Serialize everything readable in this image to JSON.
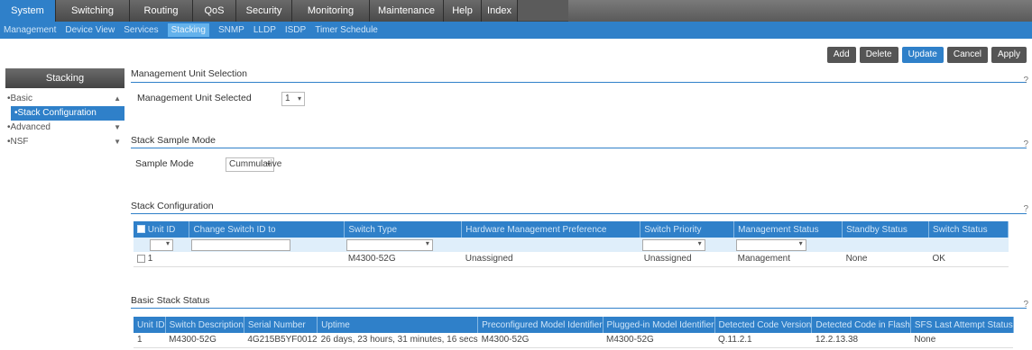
{
  "topnav": {
    "tabs": [
      {
        "label": "System",
        "active": true
      },
      {
        "label": "Switching",
        "active": false
      },
      {
        "label": "Routing",
        "active": false
      },
      {
        "label": "QoS",
        "active": false
      },
      {
        "label": "Security",
        "active": false
      },
      {
        "label": "Monitoring",
        "active": false
      },
      {
        "label": "Maintenance",
        "active": false
      },
      {
        "label": "Help",
        "active": false
      },
      {
        "label": "Index",
        "active": false
      }
    ]
  },
  "subnav": {
    "items": [
      "Management",
      "Device View",
      "Services",
      "Stacking",
      "SNMP",
      "LLDP",
      "ISDP",
      "Timer Schedule"
    ],
    "active": "Stacking"
  },
  "toolbar": {
    "add": "Add",
    "delete": "Delete",
    "update": "Update",
    "cancel": "Cancel",
    "apply": "Apply"
  },
  "leftnav": {
    "header": "Stacking",
    "items": [
      "Basic",
      "Stack Configuration",
      "Advanced",
      "NSF"
    ]
  },
  "mgmt": {
    "title": "Management Unit Selection",
    "label": "Management Unit Selected",
    "value": "1"
  },
  "sample": {
    "title": "Stack Sample Mode",
    "label": "Sample Mode",
    "value": "Cummulative"
  },
  "stack_config": {
    "title": "Stack Configuration",
    "columns": [
      "Unit ID",
      "Change Switch ID to",
      "Switch Type",
      "Hardware Management Preference",
      "Switch Priority",
      "Management Status",
      "Standby Status",
      "Switch Status"
    ],
    "rows": [
      [
        "1",
        "",
        "M4300-52G",
        "Unassigned",
        "Unassigned",
        "Management",
        "None",
        "OK"
      ]
    ]
  },
  "basic_status": {
    "title": "Basic Stack Status",
    "columns": [
      "Unit ID",
      "Switch Description",
      "Serial Number",
      "Uptime",
      "Preconfigured Model Identifier",
      "Plugged-in Model Identifier",
      "Detected Code Version",
      "Detected Code in Flash",
      "SFS Last Attempt Status"
    ],
    "rows": [
      [
        "1",
        "M4300-52G",
        "4G215B5YF0012",
        "26 days, 23 hours, 31 minutes, 16 secs",
        "M4300-52G",
        "M4300-52G",
        "Q.11.2.1",
        "12.2.13.38",
        "None"
      ]
    ]
  },
  "help_symbol": "?",
  "colors": {
    "accent": "#2f80c9",
    "dark": "#5b5b5b"
  }
}
